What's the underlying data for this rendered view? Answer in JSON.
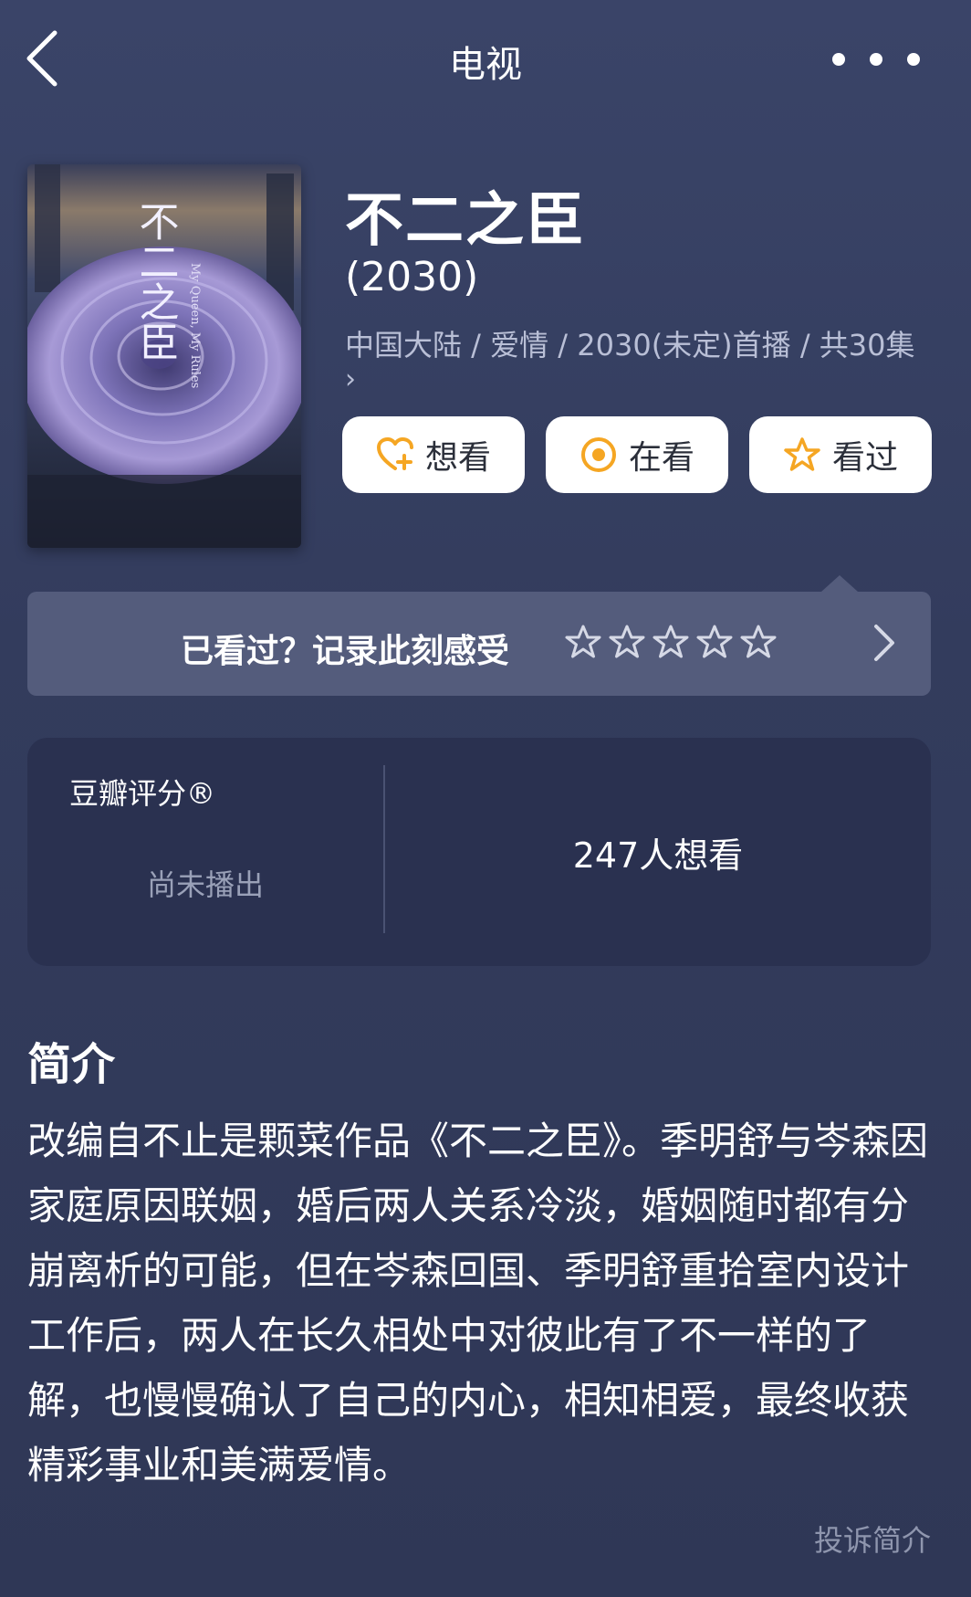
{
  "header": {
    "title": "电视",
    "back_icon": "chevron-left-icon",
    "more_icon": "more-horizontal-icon"
  },
  "poster": {
    "title_text": "不二之臣",
    "subtitle_text": "My Queen, My Rules"
  },
  "info": {
    "title": "不二之臣",
    "year": "(2030)",
    "meta": "中国大陆 / 爱情 / 2030(未定)首播 / 共30集",
    "meta_chevron": "›"
  },
  "actions": [
    {
      "label": "想看",
      "icon": "heart-plus-icon"
    },
    {
      "label": "在看",
      "icon": "target-circle-icon"
    },
    {
      "label": "看过",
      "icon": "star-icon"
    }
  ],
  "record": {
    "text": "已看过？记录此刻感受",
    "star_count": 5,
    "rating": 0
  },
  "score": {
    "label": "豆瓣评分®",
    "status": "尚未播出",
    "want_count": "247人想看"
  },
  "synopsis": {
    "title": "简介",
    "text": "改编自不止是颗菜作品《不二之臣》。季明舒与岑森因家庭原因联姻，婚后两人关系冷淡，婚姻随时都有分崩离析的可能，但在岑森回国、季明舒重拾室内设计工作后，两人在长久相处中对彼此有了不一样的了解，也慢慢确认了自己的内心，相知相爱，最终收获精彩事业和美满爱情。",
    "report_label": "投诉简介"
  },
  "colors": {
    "background": "#363f61",
    "accent": "#f5a623",
    "card": "#2a3150",
    "record_bar": "#545c7c"
  }
}
